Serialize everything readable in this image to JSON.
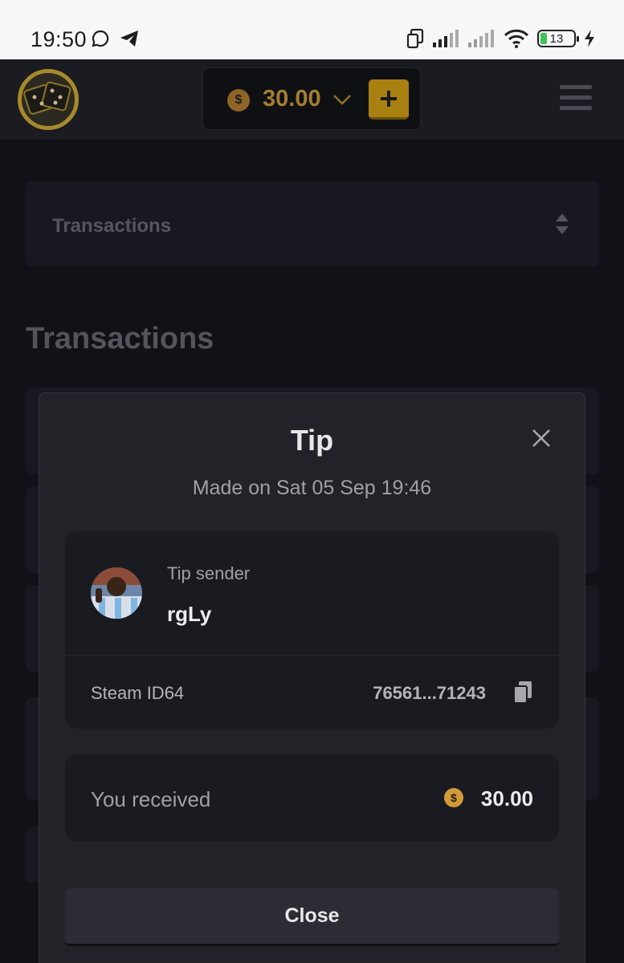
{
  "status_bar": {
    "time": "19:50",
    "battery": "13"
  },
  "header": {
    "balance": "30.00",
    "coin_symbol": "$",
    "add_label": "+"
  },
  "page": {
    "filter_label": "Transactions",
    "title": "Transactions"
  },
  "modal": {
    "title": "Tip",
    "subtitle": "Made on Sat 05 Sep 19:46",
    "sender_label": "Tip sender",
    "sender_name": "rgLy",
    "steam_label": "Steam ID64",
    "steam_value": "76561...71243",
    "received_label": "You received",
    "received_coin": "$",
    "received_value": "30.00",
    "close_label": "Close"
  },
  "colors": {
    "accent": "#a98111",
    "background": "#111217",
    "modal": "#222329"
  }
}
